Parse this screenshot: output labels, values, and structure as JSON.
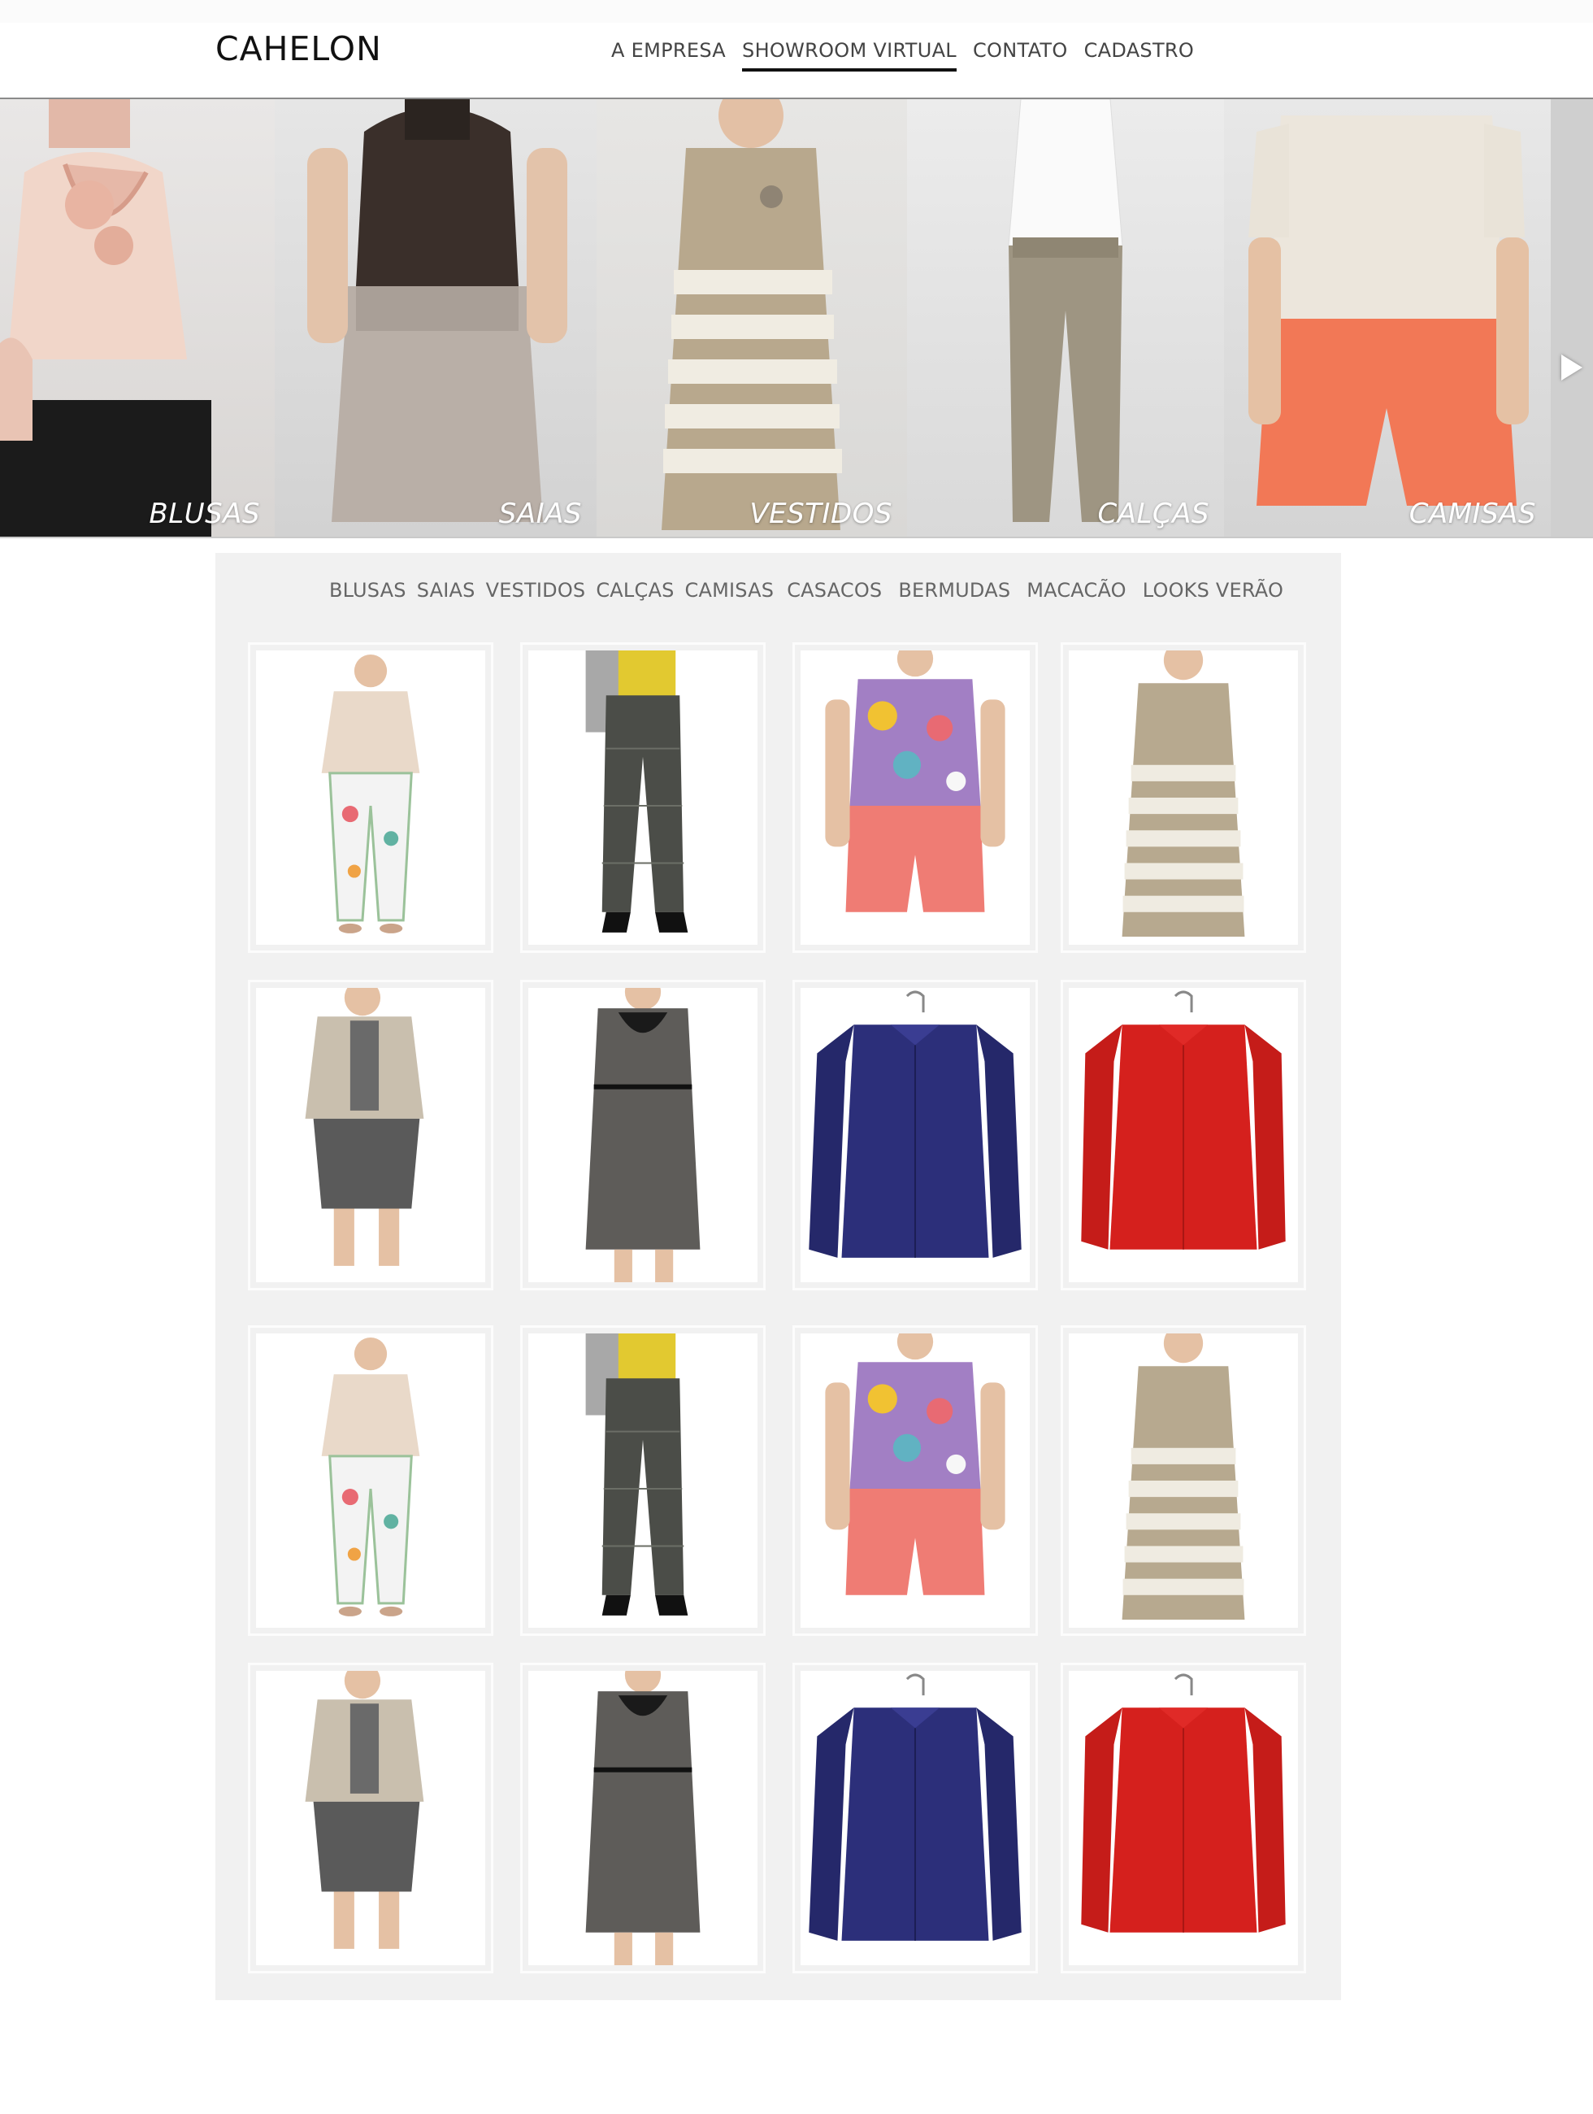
{
  "brand": "CAHELON",
  "nav": {
    "items": [
      "A EMPRESA",
      "SHOWROOM VIRTUAL",
      "CONTATO",
      "CADASTRO"
    ],
    "active": "SHOWROOM VIRTUAL"
  },
  "hero": {
    "panels": [
      {
        "label": "BLUSAS",
        "icon": "blouse-photo"
      },
      {
        "label": "SAIAS",
        "icon": "skirt-photo"
      },
      {
        "label": "VESTIDOS",
        "icon": "dress-photo"
      },
      {
        "label": "CALÇAS",
        "icon": "pants-photo"
      },
      {
        "label": "CAMISAS",
        "icon": "shirt-photo"
      }
    ],
    "next_icon": "play-arrow-icon"
  },
  "catalog": {
    "categories": [
      "BLUSAS",
      "SAIAS",
      "VESTIDOS",
      "CALÇAS",
      "CAMISAS",
      "CASACOS",
      "BERMUDAS",
      "MACACÃO",
      "LOOKS VERÃO"
    ],
    "products": [
      {
        "icon": "satin-blouse-floral-pants-photo"
      },
      {
        "icon": "plaid-pants-photo"
      },
      {
        "icon": "print-top-coral-shorts-photo"
      },
      {
        "icon": "striped-dress-photo"
      },
      {
        "icon": "blazer-skirt-photo"
      },
      {
        "icon": "grey-dress-photo"
      },
      {
        "icon": "navy-satin-shirt-photo"
      },
      {
        "icon": "red-shirt-photo"
      },
      {
        "icon": "satin-blouse-floral-pants-photo"
      },
      {
        "icon": "plaid-pants-photo"
      },
      {
        "icon": "print-top-coral-shorts-photo"
      },
      {
        "icon": "striped-dress-photo"
      },
      {
        "icon": "blazer-skirt-photo"
      },
      {
        "icon": "grey-dress-photo"
      },
      {
        "icon": "navy-satin-shirt-photo"
      },
      {
        "icon": "red-shirt-photo"
      }
    ]
  },
  "colors": {
    "catalog_bg": "#f1f1f1",
    "text_dark": "#111111",
    "text_muted": "#666666"
  }
}
